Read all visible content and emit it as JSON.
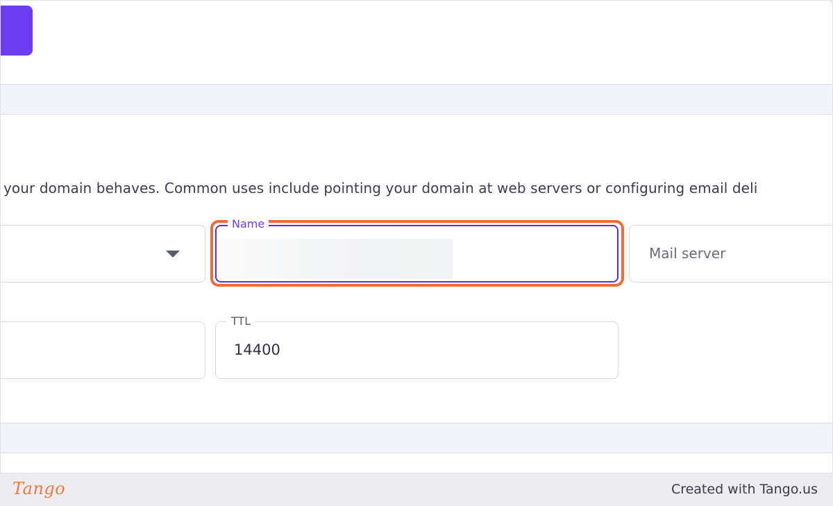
{
  "description": "your domain behaves. Common uses include pointing your domain at web servers or configuring email deli",
  "fields": {
    "name_label": "Name",
    "name_value": "",
    "value_placeholder": "Mail server",
    "ttl_label": "TTL",
    "ttl_value": "14400"
  },
  "colors": {
    "accent": "#6b3cf0",
    "highlight": "#f06b3a"
  },
  "footer": {
    "logo": "Tango",
    "credit": "Created with Tango.us"
  }
}
